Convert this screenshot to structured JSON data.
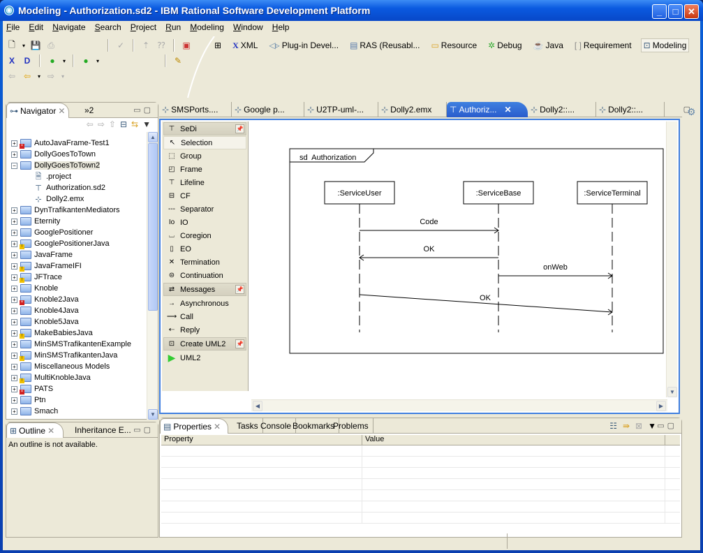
{
  "window": {
    "title": "Modeling - Authorization.sd2 - IBM Rational Software Development Platform",
    "minimize": "_",
    "maximize": "□",
    "close": "✕"
  },
  "menu": [
    "File",
    "Edit",
    "Navigate",
    "Search",
    "Project",
    "Run",
    "Modeling",
    "Window",
    "Help"
  ],
  "perspectives": [
    {
      "label": "",
      "icon": "open-perspective-icon"
    },
    {
      "label": "XML",
      "icon": "xml-icon"
    },
    {
      "label": "Plug-in Devel...",
      "icon": "plugin-icon"
    },
    {
      "label": "RAS (Reusabl...",
      "icon": "ras-icon"
    },
    {
      "label": "Resource",
      "icon": "resource-icon"
    },
    {
      "label": "Debug",
      "icon": "debug-icon"
    },
    {
      "label": "Java",
      "icon": "java-icon"
    },
    {
      "label": "Requirement",
      "icon": "requirement-icon"
    },
    {
      "label": "Modeling",
      "icon": "modeling-icon",
      "active": true
    }
  ],
  "navigator": {
    "tab_label": "Navigator",
    "overflow_label": "»2",
    "items": [
      {
        "label": "AutoJavaFrame-Test1",
        "type": "project",
        "badge": "error",
        "expanded": false
      },
      {
        "label": "DollyGoesToTown",
        "type": "project",
        "badge": "",
        "expanded": false
      },
      {
        "label": "DollyGoesToTown2",
        "type": "project",
        "badge": "",
        "expanded": true,
        "selected": true
      },
      {
        "label": ".project",
        "type": "file",
        "indent": 1
      },
      {
        "label": "Authorization.sd2",
        "type": "sd2",
        "indent": 1
      },
      {
        "label": "Dolly2.emx",
        "type": "emx",
        "indent": 1
      },
      {
        "label": "DynTrafikantenMediators",
        "type": "project",
        "badge": ""
      },
      {
        "label": "Eternity",
        "type": "project",
        "badge": ""
      },
      {
        "label": "GooglePositioner",
        "type": "project",
        "badge": ""
      },
      {
        "label": "GooglePositionerJava",
        "type": "project",
        "badge": "warning"
      },
      {
        "label": "JavaFrame",
        "type": "project",
        "badge": ""
      },
      {
        "label": "JavaFrameIFI",
        "type": "project",
        "badge": "warning"
      },
      {
        "label": "JFTrace",
        "type": "project",
        "badge": "warning"
      },
      {
        "label": "Knoble",
        "type": "project",
        "badge": ""
      },
      {
        "label": "Knoble2Java",
        "type": "project",
        "badge": "error"
      },
      {
        "label": "Knoble4Java",
        "type": "project",
        "badge": ""
      },
      {
        "label": "Knoble5Java",
        "type": "project",
        "badge": ""
      },
      {
        "label": "MakeBabiesJava",
        "type": "project",
        "badge": "warning"
      },
      {
        "label": "MinSMSTrafikantenExample",
        "type": "project",
        "badge": ""
      },
      {
        "label": "MinSMSTrafikantenJava",
        "type": "project",
        "badge": "warning"
      },
      {
        "label": "Miscellaneous Models",
        "type": "project",
        "badge": ""
      },
      {
        "label": "MultiKnobleJava",
        "type": "project",
        "badge": "warning"
      },
      {
        "label": "PATS",
        "type": "project",
        "badge": "error"
      },
      {
        "label": "Ptn",
        "type": "project",
        "badge": ""
      },
      {
        "label": "Smach",
        "type": "project",
        "badge": ""
      }
    ]
  },
  "outline": {
    "tab_label": "Outline",
    "tab2_label": "Inheritance E...",
    "message": "An outline is not available."
  },
  "editor_tabs": [
    {
      "label": "SMSPorts....",
      "active": false
    },
    {
      "label": "Google p...",
      "active": false
    },
    {
      "label": "U2TP-uml-...",
      "active": false
    },
    {
      "label": "Dolly2.emx",
      "active": false
    },
    {
      "label": "Authoriz...",
      "active": true,
      "close": "✕"
    },
    {
      "label": "Dolly2::...",
      "active": false
    },
    {
      "label": "Dolly2::...",
      "active": false
    }
  ],
  "palette": {
    "drawers": [
      {
        "label": "SeDi",
        "items": [
          "Selection",
          "Group",
          "Frame",
          "Lifeline",
          "CF",
          "Separator",
          "IO",
          "Coregion",
          "EO",
          "Termination",
          "Continuation"
        ]
      },
      {
        "label": "Messages",
        "items": [
          "Asynchronous",
          "Call",
          "Reply"
        ]
      },
      {
        "label": "Create UML2",
        "items": [
          "UML2"
        ]
      }
    ]
  },
  "diagram": {
    "frame_label": "sd  Authorization",
    "lifelines": [
      ":ServiceUser",
      ":ServiceBase",
      ":ServiceTerminal"
    ],
    "messages": [
      {
        "label": "Code",
        "from": 0,
        "to": 1
      },
      {
        "label": "OK",
        "from": 1,
        "to": 0
      },
      {
        "label": "onWeb",
        "from": 1,
        "to": 2
      },
      {
        "label": "OK",
        "from": 0,
        "to": 2
      }
    ]
  },
  "bottom_panel": {
    "tabs": [
      "Properties",
      "Tasks",
      "Console",
      "Bookmarks",
      "Problems"
    ],
    "columns": [
      "Property",
      "Value"
    ]
  }
}
